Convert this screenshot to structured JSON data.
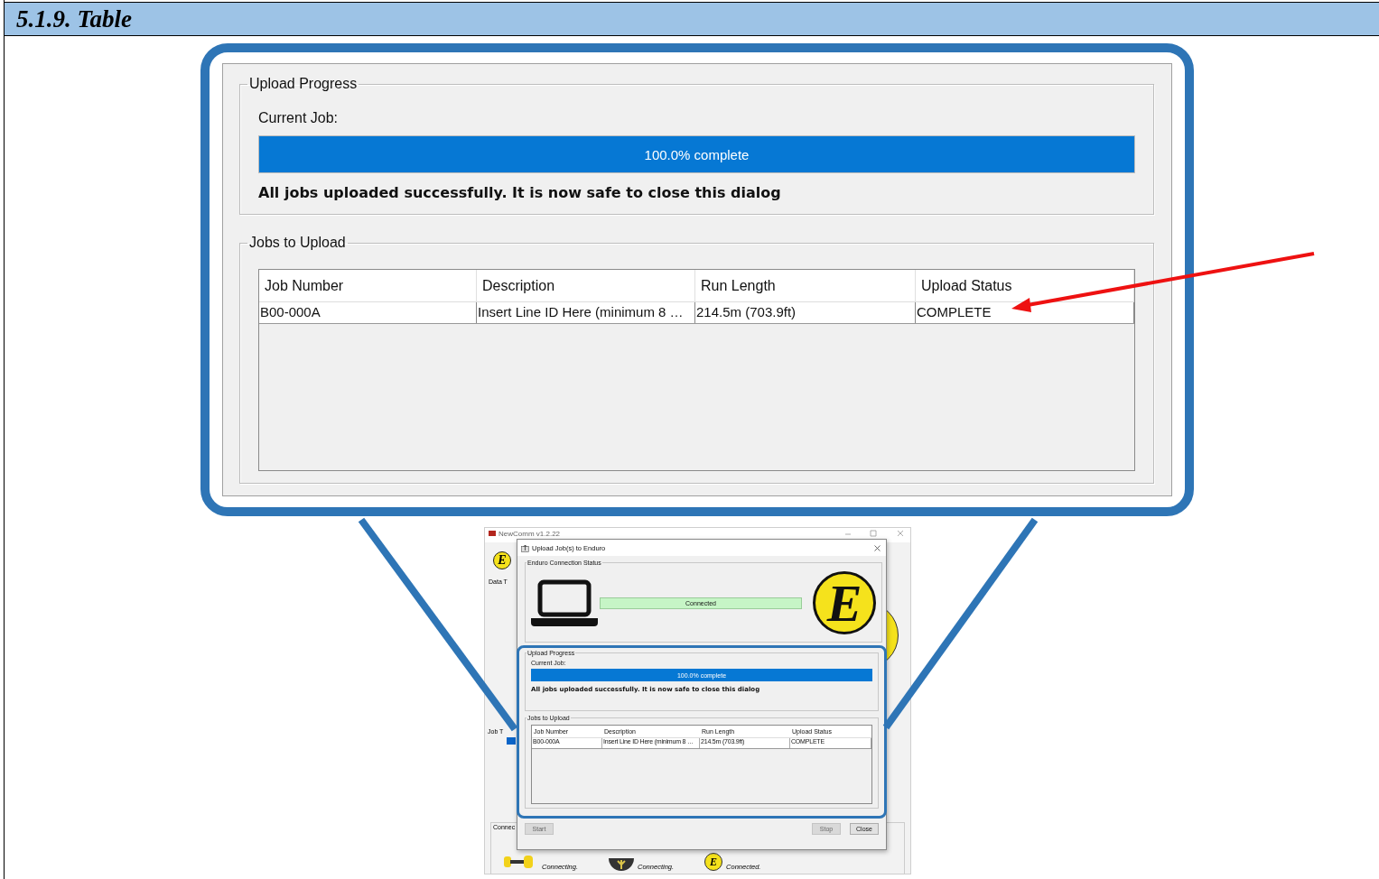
{
  "section_heading": "5.1.9. Table",
  "callout_view": {
    "upload_progress": {
      "legend": "Upload Progress",
      "current_job_label": "Current Job:",
      "progress_text": "100.0% complete",
      "level": 1,
      "message": "All jobs uploaded successfully. It is now safe to close this dialog"
    },
    "jobs_to_upload": {
      "legend": "Jobs to Upload",
      "columns": [
        "Job Number",
        "Description",
        "Run Length",
        "Upload Status"
      ],
      "rows": [
        [
          "B00-000A",
          "Insert Line ID Here (minimum 8 …",
          "214.5m (703.9ft)",
          "COMPLETE"
        ]
      ]
    }
  },
  "screenshot": {
    "app_window": {
      "title": "NewComm v1.2.22",
      "logo_letter": "E",
      "data_label": "Data T",
      "job_label": "Job T",
      "connection_label": "Connec",
      "devices": [
        {
          "kind": "crawler",
          "status": "Connecting."
        },
        {
          "kind": "reel",
          "status": "Connecting."
        },
        {
          "kind": "logo",
          "letter": "E",
          "status": "Connected."
        }
      ]
    },
    "dialog": {
      "title": "Upload Job(s) to Enduro",
      "connection_status": {
        "legend": "Enduro Connection Status",
        "status_text": "Connected",
        "logo_letter": "E"
      },
      "upload_progress": {
        "legend": "Upload Progress",
        "current_job_label": "Current Job:",
        "progress_text": "100.0% complete",
        "level": 1,
        "message": "All jobs uploaded successfully. It is now safe to close this dialog"
      },
      "jobs_to_upload": {
        "legend": "Jobs to Upload",
        "columns": [
          "Job Number",
          "Description",
          "Run Length",
          "Upload Status"
        ],
        "rows": [
          [
            "B00-000A",
            "Insert Line ID Here (minimum 8 …",
            "214.5m (703.9ft)",
            "COMPLETE"
          ]
        ]
      },
      "left_buttons": [
        {
          "label": "Start",
          "disabled": true
        }
      ],
      "right_buttons": [
        {
          "label": "Stop",
          "disabled": true
        },
        {
          "label": "Close",
          "disabled": false
        }
      ]
    }
  }
}
